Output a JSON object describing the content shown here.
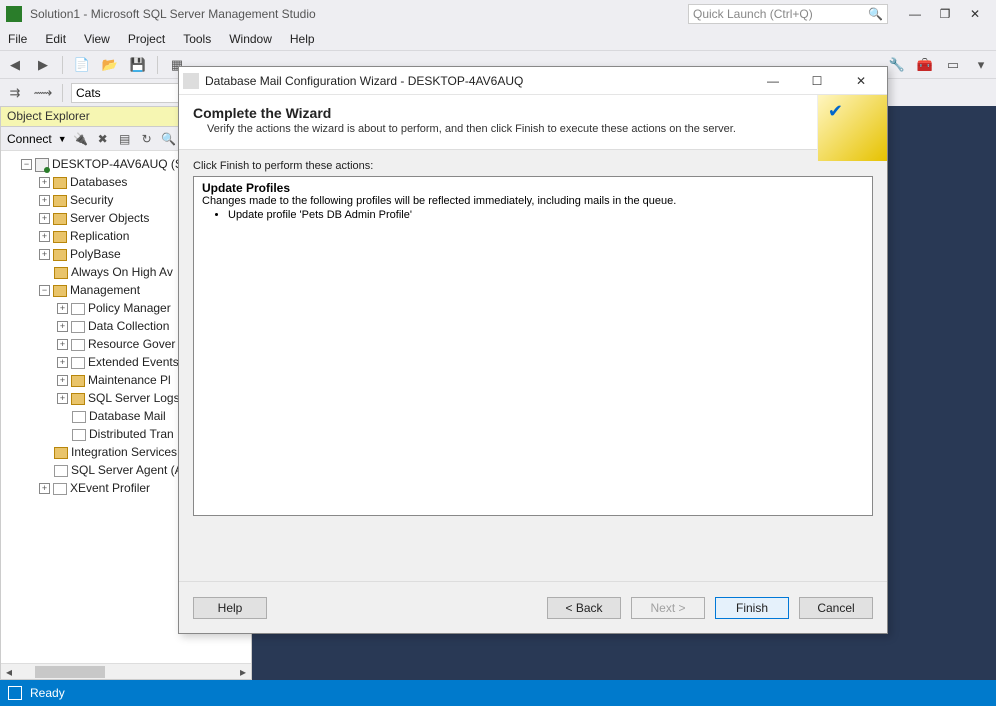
{
  "app": {
    "title": "Solution1 - Microsoft SQL Server Management Studio",
    "quick_launch_placeholder": "Quick Launch (Ctrl+Q)"
  },
  "menu": {
    "file": "File",
    "edit": "Edit",
    "view": "View",
    "project": "Project",
    "tools": "Tools",
    "window": "Window",
    "help": "Help"
  },
  "toolbar": {
    "context_value": "Cats"
  },
  "explorer": {
    "title": "Object Explorer",
    "connect_label": "Connect",
    "server": "DESKTOP-4AV6AUQ (S",
    "nodes": {
      "databases": "Databases",
      "security": "Security",
      "server_objects": "Server Objects",
      "replication": "Replication",
      "polybase": "PolyBase",
      "always_on": "Always On High Av",
      "management": "Management",
      "mgmt_children": {
        "policy": "Policy Manager",
        "data_collection": "Data Collection",
        "resource_gov": "Resource Gover",
        "extended_events": "Extended Events",
        "maint_plans": "Maintenance Pl",
        "sql_logs": "SQL Server Logs",
        "db_mail": "Database Mail",
        "dtc": "Distributed Tran"
      },
      "integration": "Integration Services",
      "agent": "SQL Server Agent (A",
      "xevent": "XEvent Profiler"
    }
  },
  "dialog": {
    "title": "Database Mail Configuration Wizard - DESKTOP-4AV6AUQ",
    "heading": "Complete the Wizard",
    "subheading": "Verify the actions the wizard is about to perform, and then click Finish to execute these actions on the server.",
    "actions_label": "Click Finish to perform these actions:",
    "section_title": "Update Profiles",
    "section_desc": "Changes made to the following profiles will be reflected immediately, including mails in the queue.",
    "bullet1": "Update profile 'Pets DB Admin Profile'",
    "buttons": {
      "help": "Help",
      "back": "< Back",
      "next": "Next >",
      "finish": "Finish",
      "cancel": "Cancel"
    }
  },
  "statusbar": {
    "ready": "Ready"
  }
}
